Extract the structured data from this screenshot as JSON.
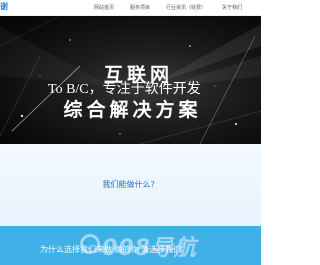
{
  "nav": {
    "logo_text": "谢",
    "items": [
      {
        "label": "网站首页"
      },
      {
        "label": "服务项目"
      },
      {
        "label": "行业资讯（收费）"
      },
      {
        "label": "关于我们"
      }
    ]
  },
  "hero": {
    "title_cn": "互联网",
    "subtitle_en": "To B/C，专注于软件开发",
    "title_cn_2": "综合解决方案"
  },
  "section_do": {
    "title": "我们能做什么？"
  },
  "section_why": {
    "title": "为什么选择我们来做·做的你·请选择我们"
  },
  "watermark": {
    "text": "008导航"
  },
  "colors": {
    "brand_blue": "#2f7fd8",
    "section_blue": "#3fb0e8",
    "hero_bg": "#0c0c0c"
  }
}
